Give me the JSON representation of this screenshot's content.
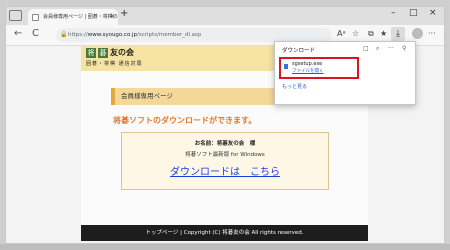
{
  "browser": {
    "tab_title": "会員様専用ページ | 囲碁・将棋の",
    "tab_close": "×",
    "new_tab": "+",
    "nav": {
      "back": "←",
      "refresh": "C"
    },
    "url_prefix": "https://",
    "url_host": "www.syougo.co.jp",
    "url_path": "/scripts/member_dl.asp",
    "window_controls": {
      "minimize": "–",
      "restore": "□",
      "close": "×"
    }
  },
  "toolbar": {
    "read_aloud": "Aᵃ",
    "favorite": "☆",
    "collections": "⧉",
    "favorites": "★",
    "download": "⤓",
    "more": "···"
  },
  "page": {
    "logo": {
      "kanji1": "将",
      "kanji2": "碁",
      "text": "友の会",
      "subtitle": "囲碁・将棋 通信対局"
    },
    "banner": "会員様専用ページ",
    "headline": "将碁ソフトのダウンロードができます。",
    "member_name": "お名前：将碁友の会　様",
    "software": "将碁ソフト最新版 for Windows",
    "download_link": "ダウンロードは　こちら",
    "footer": "トップページ | Copyright (C) 将碁友の会 All rights reserved."
  },
  "downloads": {
    "title": "ダウンロード",
    "icons": {
      "folder": "□",
      "search": "⌕",
      "more": "···",
      "pin": "⚲"
    },
    "file_name": "sgsetup.exe",
    "open_file": "ファイルを開く",
    "see_more": "もっと見る"
  }
}
